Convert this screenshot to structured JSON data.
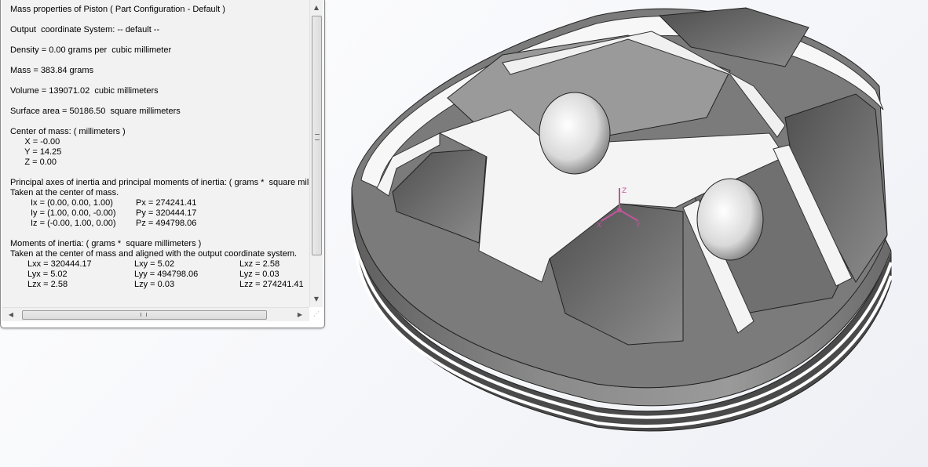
{
  "report": {
    "lines": [
      {
        "text": "Mass properties of Piston ( Part Configuration - Default )",
        "blank_after": true
      },
      {
        "text": "Output  coordinate System: -- default --",
        "blank_after": true
      },
      {
        "text": "Density = 0.00 grams per  cubic millimeter",
        "blank_after": true
      },
      {
        "text": "Mass = 383.84 grams",
        "blank_after": true
      },
      {
        "text": "Volume = 139071.02  cubic millimeters",
        "blank_after": true
      },
      {
        "text": "Surface area = 50186.50  square millimeters",
        "blank_after": true
      },
      {
        "text": "Center of mass: ( millimeters )"
      },
      {
        "text": "      X = -0.00"
      },
      {
        "text": "      Y = 14.25"
      },
      {
        "text": "      Z = 0.00",
        "blank_after": true
      },
      {
        "text": "Principal axes of inertia and principal moments of inertia: ( grams *  square mill"
      },
      {
        "text": "Taken at the center of mass."
      }
    ],
    "principal_axes": [
      {
        "axis": "Ix = (0.00, 0.00, 1.00)",
        "moment": "Px = 274241.41"
      },
      {
        "axis": "Iy = (1.00, 0.00, -0.00)",
        "moment": "Py = 320444.17"
      },
      {
        "axis": "Iz = (-0.00, 1.00, 0.00)",
        "moment": "Pz = 494798.06"
      }
    ],
    "moments_header": "Moments of inertia: ( grams *  square millimeters )",
    "moments_subheader": "Taken at the center of mass and aligned with the output coordinate system.",
    "moments": [
      [
        "Lxx = 320444.17",
        "Lxy = 5.02",
        "Lxz = 2.58"
      ],
      [
        "Lyx = 5.02",
        "Lyy = 494798.06",
        "Lyz = 0.03"
      ],
      [
        "Lzx = 2.58",
        "Lzy = 0.03",
        "Lzz = 274241.41"
      ]
    ]
  },
  "triad": {
    "x_label": "X",
    "y_label": "Y",
    "z_label": "Z",
    "color": "#c0569a"
  },
  "icons": {
    "scroll_up": "scroll-up-arrow-icon",
    "scroll_down": "scroll-down-arrow-icon",
    "scroll_left": "scroll-left-arrow-icon",
    "scroll_right": "scroll-right-arrow-icon"
  },
  "colors": {
    "panel_bg": "#f2f2f2",
    "model_face": "#f5f5f5",
    "model_shadow": "#6b6b6b"
  }
}
